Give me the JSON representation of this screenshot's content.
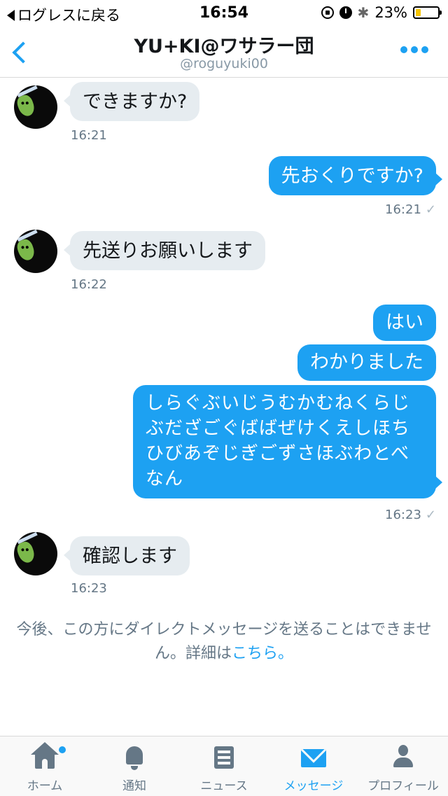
{
  "status_bar": {
    "back_label": "ログレスに戻る",
    "time": "16:54",
    "battery": "23%",
    "battery_level": 0.23,
    "icons": [
      "rotation-lock-icon",
      "alarm-icon",
      "bluetooth-icon",
      "battery-icon"
    ]
  },
  "header": {
    "title": "YU+KI@ワサラー団",
    "handle": "@roguyuki00",
    "back_icon": "chevron-left-icon",
    "more_icon": "more-dots-icon"
  },
  "messages": [
    {
      "direction": "in",
      "text": "できますか?",
      "time": "16:21"
    },
    {
      "direction": "out",
      "text": "先おくりですか?",
      "time": "16:21"
    },
    {
      "direction": "in",
      "text": "先送りお願いします",
      "time": "16:22"
    },
    {
      "direction": "out",
      "text": "はい"
    },
    {
      "direction": "out",
      "text": "わかりました"
    },
    {
      "direction": "out",
      "text": "しらぐぶいじうむかむねくらじぶだざごぐばばぜけくえしほちひびあぞじぎごずさほぶわとべなん",
      "time": "16:23"
    },
    {
      "direction": "in",
      "text": "確認します",
      "time": "16:23"
    }
  ],
  "notice": {
    "text": "今後、この方にダイレクトメッセージを送ることはできません。詳細は",
    "link": "こちら。"
  },
  "tabs": [
    {
      "label": "ホーム",
      "icon": "home-icon"
    },
    {
      "label": "通知",
      "icon": "bell-icon"
    },
    {
      "label": "ニュース",
      "icon": "news-icon"
    },
    {
      "label": "メッセージ",
      "icon": "mail-icon",
      "active": true
    },
    {
      "label": "プロフィール",
      "icon": "person-icon"
    }
  ],
  "colors": {
    "accent": "#1da1f2",
    "incoming_bubble": "#e6ecf0",
    "muted": "#657786"
  }
}
